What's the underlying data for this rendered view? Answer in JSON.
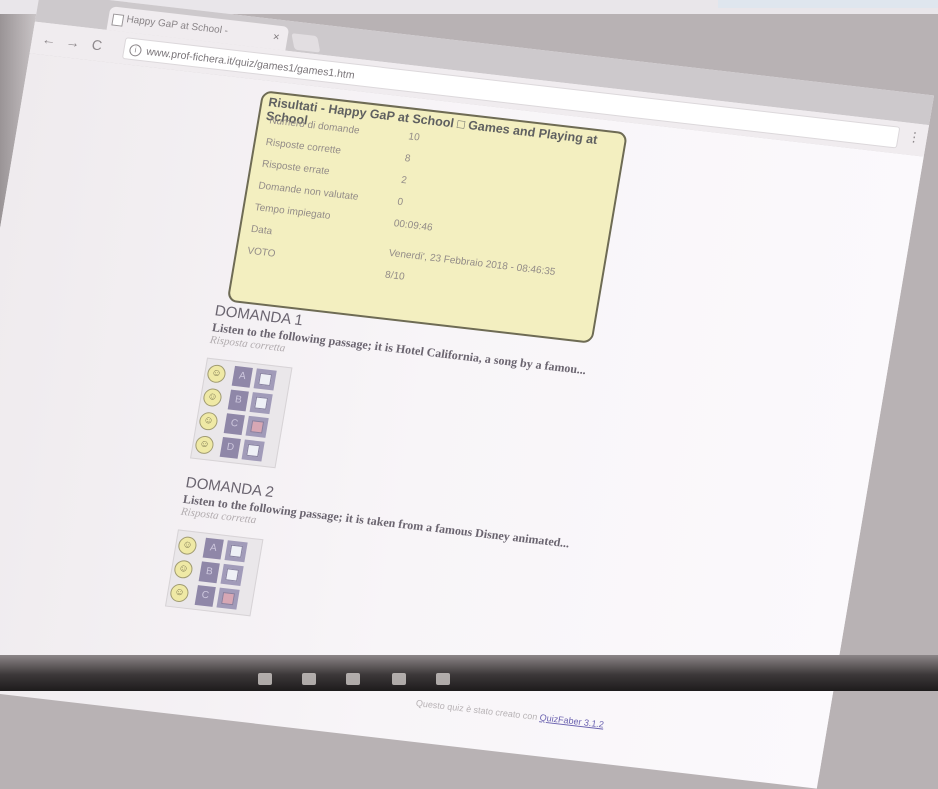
{
  "browser": {
    "tab_title": "Happy GaP at School - ",
    "tab_close": "×",
    "back": "←",
    "forward": "→",
    "reload": "C",
    "url": "www.prof-fichera.it/quiz/games1/games1.htm",
    "menu": "⋮"
  },
  "results": {
    "title": "Risultati - Happy GaP at School □ Games and Playing at School",
    "rows": [
      {
        "label": "Numero di domande",
        "value": "10"
      },
      {
        "label": "Risposte corrette",
        "value": "8"
      },
      {
        "label": "Risposte errate",
        "value": "2"
      },
      {
        "label": "Domande non valutate",
        "value": "0"
      },
      {
        "label": "Tempo impiegato",
        "value": "00:09:46"
      },
      {
        "label": "Data",
        "value": "Venerdi', 23 Febbraio 2018 - 08:46:35"
      },
      {
        "label": "VOTO",
        "value": "8/10"
      }
    ]
  },
  "questions": [
    {
      "title": "DOMANDA 1",
      "text": "Listen to the following passage; it is Hotel California, a song by a famou...",
      "status": "Risposta corretta",
      "answers": [
        {
          "letter": "A",
          "checked": false
        },
        {
          "letter": "B",
          "checked": false
        },
        {
          "letter": "C",
          "checked": true
        },
        {
          "letter": "D",
          "checked": false
        }
      ]
    },
    {
      "title": "DOMANDA 2",
      "text": "Listen to the following passage; it is taken from a famous Disney animated...",
      "status": "Risposta corretta",
      "answers": [
        {
          "letter": "A",
          "checked": false
        },
        {
          "letter": "B",
          "checked": false
        },
        {
          "letter": "C",
          "checked": true
        }
      ]
    }
  ],
  "footer": {
    "text": "Questo quiz è stato creato con ",
    "link": "QuizFaber 3.1.2"
  },
  "colors": {
    "results_bg": "#f3efc0",
    "answer_letter_bg": "#8f87a8",
    "link": "#6b62b0"
  }
}
